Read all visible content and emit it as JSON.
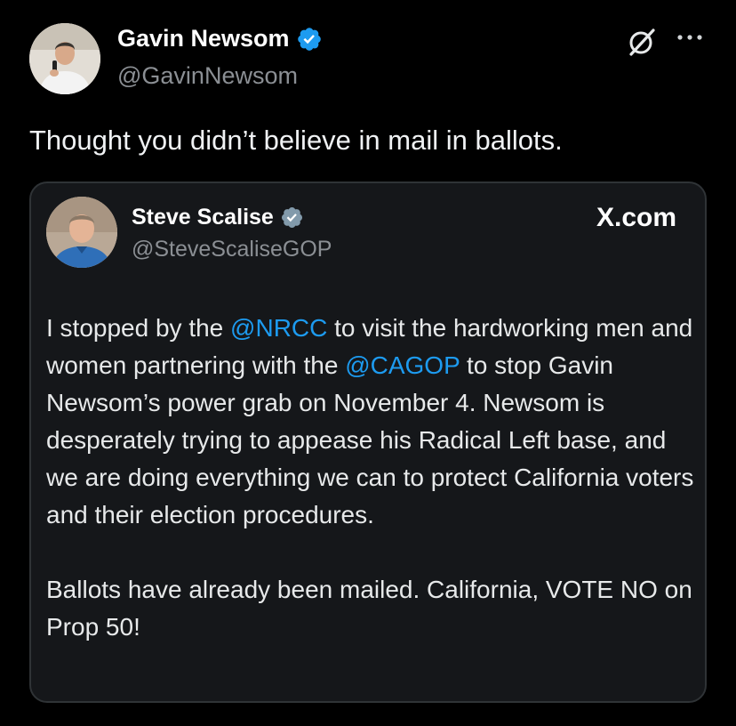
{
  "tweet": {
    "author_name": "Gavin Newsom",
    "author_handle": "@GavinNewsom",
    "text": "Thought you didn’t believe in mail in ballots.",
    "more_icon": "more-horizontal-icon",
    "grok_icon": "grok-icon",
    "verified_icon": "verified-badge-icon",
    "verified_color": "#1d9bf0"
  },
  "quote": {
    "author_name": "Steve Scalise",
    "author_handle": "@SteveScaliseGOP",
    "source": "X.com",
    "verified_icon": "verified-badge-icon",
    "verified_color": "#829aab",
    "mention_color": "#1d9bf0",
    "p1": {
      "t1": "I stopped by the ",
      "m1": "@NRCC",
      "t2": " to visit the hardworking men and women partnering with the ",
      "m2": "@CAGOP",
      "t3": " to stop Gavin Newsom’s power grab on November 4. Newsom is desperately trying to appease his Radical Left base, and we are doing everything we can to protect California voters and their election procedures."
    },
    "p2": "Ballots have already been mailed. California, VOTE NO on Prop 50!"
  }
}
